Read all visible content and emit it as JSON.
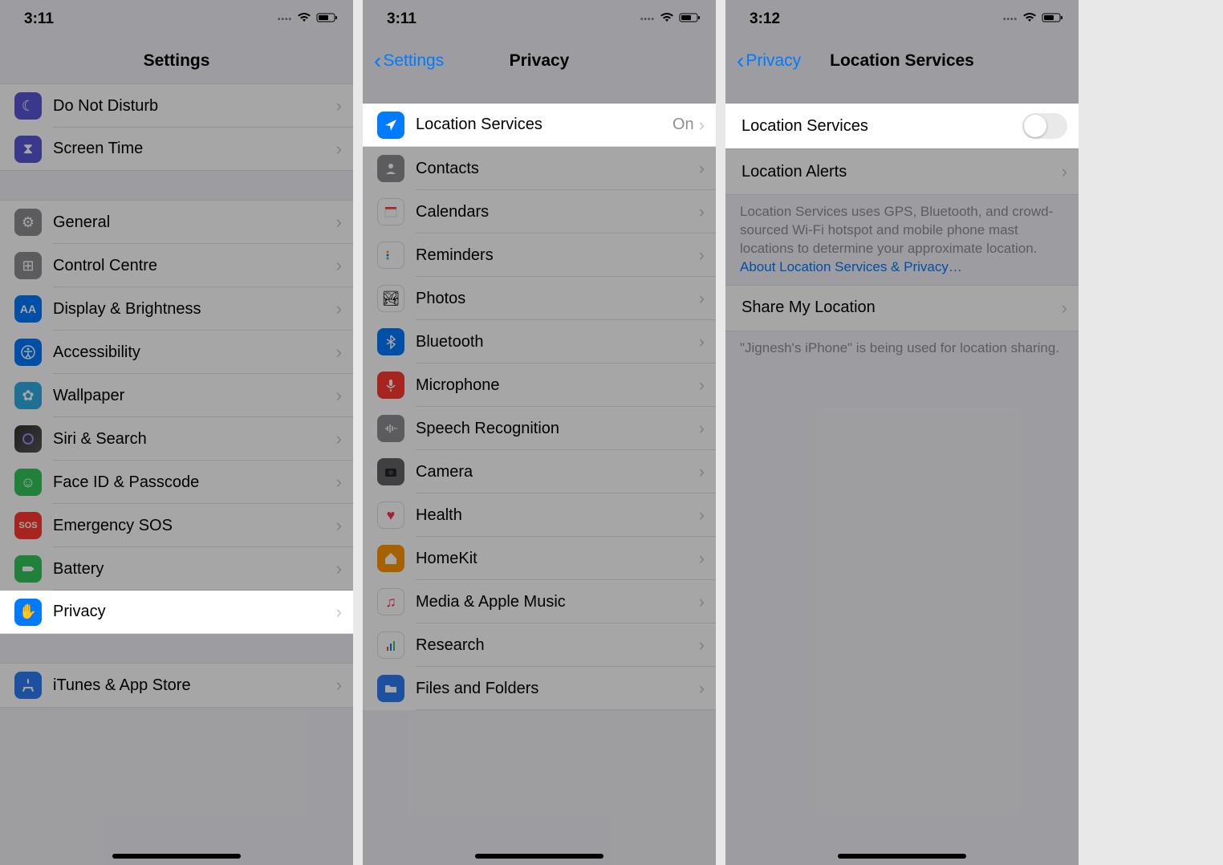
{
  "screen1": {
    "time": "3:11",
    "title": "Settings",
    "groups": [
      [
        {
          "label": "Do Not Disturb",
          "icon": "moon-icon",
          "bg": "bg-purple"
        },
        {
          "label": "Screen Time",
          "icon": "hourglass-icon",
          "bg": "bg-indigo"
        }
      ],
      [
        {
          "label": "General",
          "icon": "gear-icon",
          "bg": "bg-gray"
        },
        {
          "label": "Control Centre",
          "icon": "switch-icon",
          "bg": "bg-gray"
        },
        {
          "label": "Display & Brightness",
          "icon": "text-size-icon",
          "bg": "bg-blue"
        },
        {
          "label": "Accessibility",
          "icon": "accessibility-icon",
          "bg": "bg-blue"
        },
        {
          "label": "Wallpaper",
          "icon": "flower-icon",
          "bg": "bg-cyan"
        },
        {
          "label": "Siri & Search",
          "icon": "siri-icon",
          "bg": "bg-multi"
        },
        {
          "label": "Face ID & Passcode",
          "icon": "face-icon",
          "bg": "bg-green"
        },
        {
          "label": "Emergency SOS",
          "icon": "sos-icon",
          "bg": "bg-red"
        },
        {
          "label": "Battery",
          "icon": "battery-icon",
          "bg": "bg-green"
        },
        {
          "label": "Privacy",
          "icon": "hand-icon",
          "bg": "bg-blue",
          "highlight": true
        }
      ],
      [
        {
          "label": "iTunes & App Store",
          "icon": "appstore-icon",
          "bg": "bg-bblue"
        }
      ]
    ]
  },
  "screen2": {
    "time": "3:11",
    "back": "Settings",
    "title": "Privacy",
    "rows": [
      {
        "label": "Location Services",
        "icon": "location-icon",
        "bg": "bg-blue",
        "detail": "On",
        "highlight": true
      },
      {
        "label": "Contacts",
        "icon": "contacts-icon",
        "bg": "bg-gray"
      },
      {
        "label": "Calendars",
        "icon": "calendar-icon",
        "bg": "bg-white"
      },
      {
        "label": "Reminders",
        "icon": "reminders-icon",
        "bg": "bg-white"
      },
      {
        "label": "Photos",
        "icon": "photos-icon",
        "bg": "bg-white"
      },
      {
        "label": "Bluetooth",
        "icon": "bluetooth-icon",
        "bg": "bg-blue"
      },
      {
        "label": "Microphone",
        "icon": "mic-icon",
        "bg": "bg-red"
      },
      {
        "label": "Speech Recognition",
        "icon": "speech-icon",
        "bg": "bg-gray"
      },
      {
        "label": "Camera",
        "icon": "camera-icon",
        "bg": "bg-darkgray"
      },
      {
        "label": "Health",
        "icon": "health-icon",
        "bg": "bg-white"
      },
      {
        "label": "HomeKit",
        "icon": "home-icon",
        "bg": "bg-orange"
      },
      {
        "label": "Media & Apple Music",
        "icon": "music-icon",
        "bg": "bg-white"
      },
      {
        "label": "Research",
        "icon": "research-icon",
        "bg": "bg-white"
      },
      {
        "label": "Files and Folders",
        "icon": "folder-icon",
        "bg": "bg-bblue"
      }
    ]
  },
  "screen3": {
    "time": "3:12",
    "back": "Privacy",
    "title": "Location Services",
    "toggle_row": {
      "label": "Location Services",
      "on": false,
      "highlight": true
    },
    "rows_after": [
      {
        "label": "Location Alerts"
      }
    ],
    "desc1_pre": "Location Services uses GPS, Bluetooth, and crowd-sourced Wi-Fi hotspot and mobile phone mast locations to determine your approximate location. ",
    "desc1_link": "About Location Services & Privacy…",
    "share_row": {
      "label": "Share My Location"
    },
    "desc2": "\"Jignesh's iPhone\" is being used for location sharing."
  }
}
